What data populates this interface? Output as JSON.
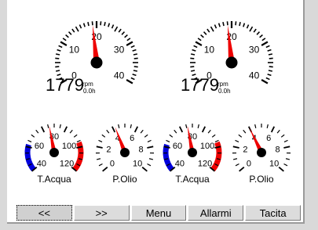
{
  "rpm_gauges": [
    {
      "value_text": "1779",
      "unit": "rpm",
      "hours": "0.0h",
      "ticks": [
        "0",
        "10",
        "20",
        "30",
        "40"
      ],
      "needle_value": 19
    },
    {
      "value_text": "1779",
      "unit": "rpm",
      "hours": "0.0h",
      "ticks": [
        "0",
        "10",
        "20",
        "30",
        "40"
      ],
      "needle_value": 19
    }
  ],
  "small_gauges": [
    {
      "label": "T.Acqua",
      "type": "temp",
      "ticks": [
        "40",
        "60",
        "80",
        "100",
        "120"
      ],
      "needle_fraction": 0.46
    },
    {
      "label": "P.Olio",
      "type": "pressure",
      "ticks": [
        "0",
        "2",
        "4",
        "6",
        "8",
        "10"
      ],
      "needle_fraction": 0.42
    },
    {
      "label": "T.Acqua",
      "type": "temp",
      "ticks": [
        "40",
        "60",
        "80",
        "100",
        "120"
      ],
      "needle_fraction": 0.46
    },
    {
      "label": "P.Olio",
      "type": "pressure",
      "ticks": [
        "0",
        "2",
        "4",
        "6",
        "8",
        "10"
      ],
      "needle_fraction": 0.4
    }
  ],
  "buttons": [
    {
      "label": "<<",
      "active": true
    },
    {
      "label": ">>"
    },
    {
      "label": "Menu"
    },
    {
      "label": "Allarmi"
    },
    {
      "label": "Tacita"
    }
  ],
  "colors": {
    "needle": "#ee0000",
    "cold": "#0000dd",
    "hot": "#ee0000"
  }
}
